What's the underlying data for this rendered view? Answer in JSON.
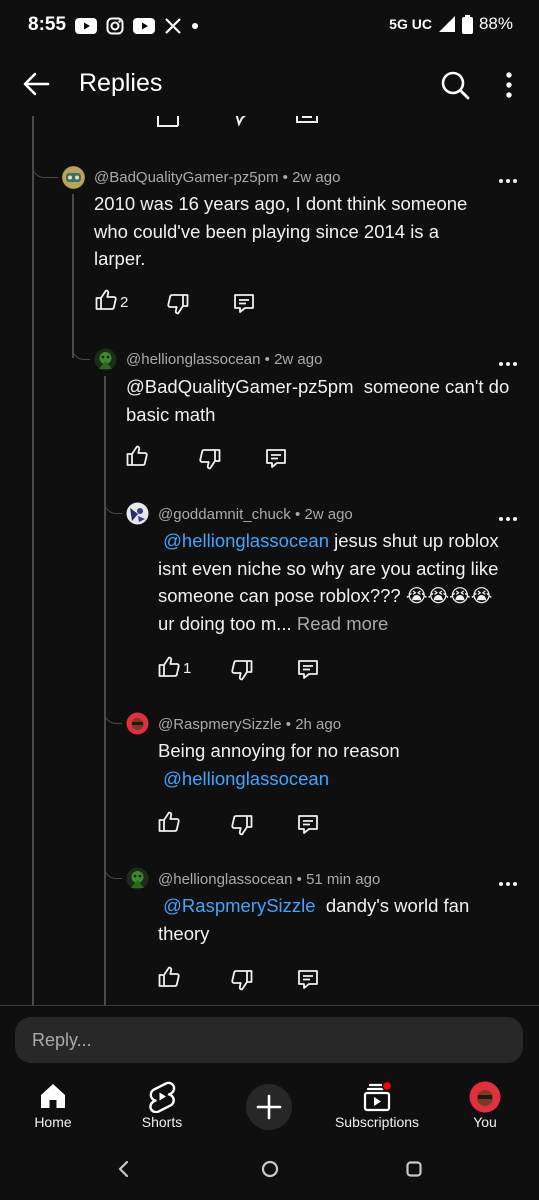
{
  "status_bar": {
    "time": "8:55",
    "icons": [
      "youtube-icon",
      "instagram-icon",
      "youtube-icon",
      "x-icon",
      "dot-icon"
    ],
    "network": "5G UC",
    "battery": "88%"
  },
  "header": {
    "title": "Replies"
  },
  "comments": [
    {
      "author": "@BadQualityGamer-pz5pm",
      "time": "2w ago",
      "text_parts": [
        {
          "t": "2010 was 16 years ago, I dont think someone who could've been playing since 2014 is a larper.",
          "type": "text"
        }
      ],
      "likes": "2"
    },
    {
      "author": "@hellionglassocean",
      "time": "2w ago",
      "text_parts": [
        {
          "t": "@BadQualityGamer-pz5pm  someone can't do basic math",
          "type": "text"
        }
      ],
      "likes": ""
    },
    {
      "author": "@goddamnit_chuck",
      "time": "2w ago",
      "text_parts": [
        {
          "t": "@hellionglassocean",
          "type": "mention"
        },
        {
          "t": " jesus shut up roblox isnt even niche so why are you acting like someone can pose roblox??? 😭😭😭😭 ur doing too m... ",
          "type": "text"
        },
        {
          "t": "Read more",
          "type": "readmore"
        }
      ],
      "likes": "1"
    },
    {
      "author": "@RaspmerySizzle",
      "time": "2h ago",
      "text_parts": [
        {
          "t": "Being annoying for no reason",
          "type": "text"
        },
        {
          "t": "@hellionglassocean",
          "type": "mention"
        }
      ],
      "likes": ""
    },
    {
      "author": "@hellionglassocean",
      "time": "51 min ago",
      "text_parts": [
        {
          "t": "@RaspmerySizzle",
          "type": "mention"
        },
        {
          "t": "  dandy's world fan theory",
          "type": "text"
        }
      ],
      "likes": ""
    }
  ],
  "reply_bar": {
    "placeholder": "Reply..."
  },
  "bottom_nav": [
    {
      "label": "Home",
      "icon": "home-icon"
    },
    {
      "label": "Shorts",
      "icon": "shorts-icon"
    },
    {
      "label": "",
      "icon": "create-plus-icon"
    },
    {
      "label": "Subscriptions",
      "icon": "subscriptions-icon"
    },
    {
      "label": "You",
      "icon": "avatar"
    }
  ],
  "colors": {
    "background": "#0f0f0f",
    "mention": "#3ea6ff",
    "meta": "#aaaaaa",
    "notification": "#ff0000"
  }
}
